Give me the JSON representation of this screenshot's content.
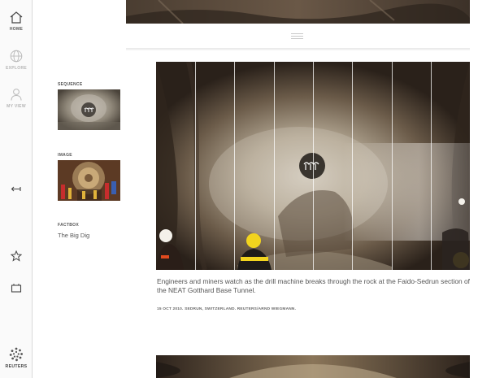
{
  "nav": {
    "home_label": "HOME",
    "explore_label": "EXPLORE",
    "myview_label": "MY VIEW",
    "brand_label": "REUTERS"
  },
  "related": {
    "sequence_heading": "SEQUENCE",
    "image_heading": "IMAGE",
    "factbox_heading": "FACTBOX",
    "factbox_link": "The Big Dig"
  },
  "photo": {
    "slices": 8
  },
  "story": {
    "caption": "Engineers and miners watch as the drill machine breaks through the rock at the Faido-Sedrun section of the NEAT Gotthard Base Tunnel.",
    "credit": "15 OCT 2010. SEDRUN, SWITZERLAND. REUTERS/ARND WIEGMANN."
  },
  "icons": {
    "home": "home-icon",
    "explore": "globe-icon",
    "myview": "person-icon",
    "back": "back-arrow-icon",
    "favorite": "star-icon",
    "share": "tray-icon",
    "brand": "reuters-dots-logo",
    "sequence": "sequence-play-icon"
  },
  "colors": {
    "rail_bg": "#fafafa",
    "text": "#555555",
    "photo_dark": "#2b231d"
  }
}
